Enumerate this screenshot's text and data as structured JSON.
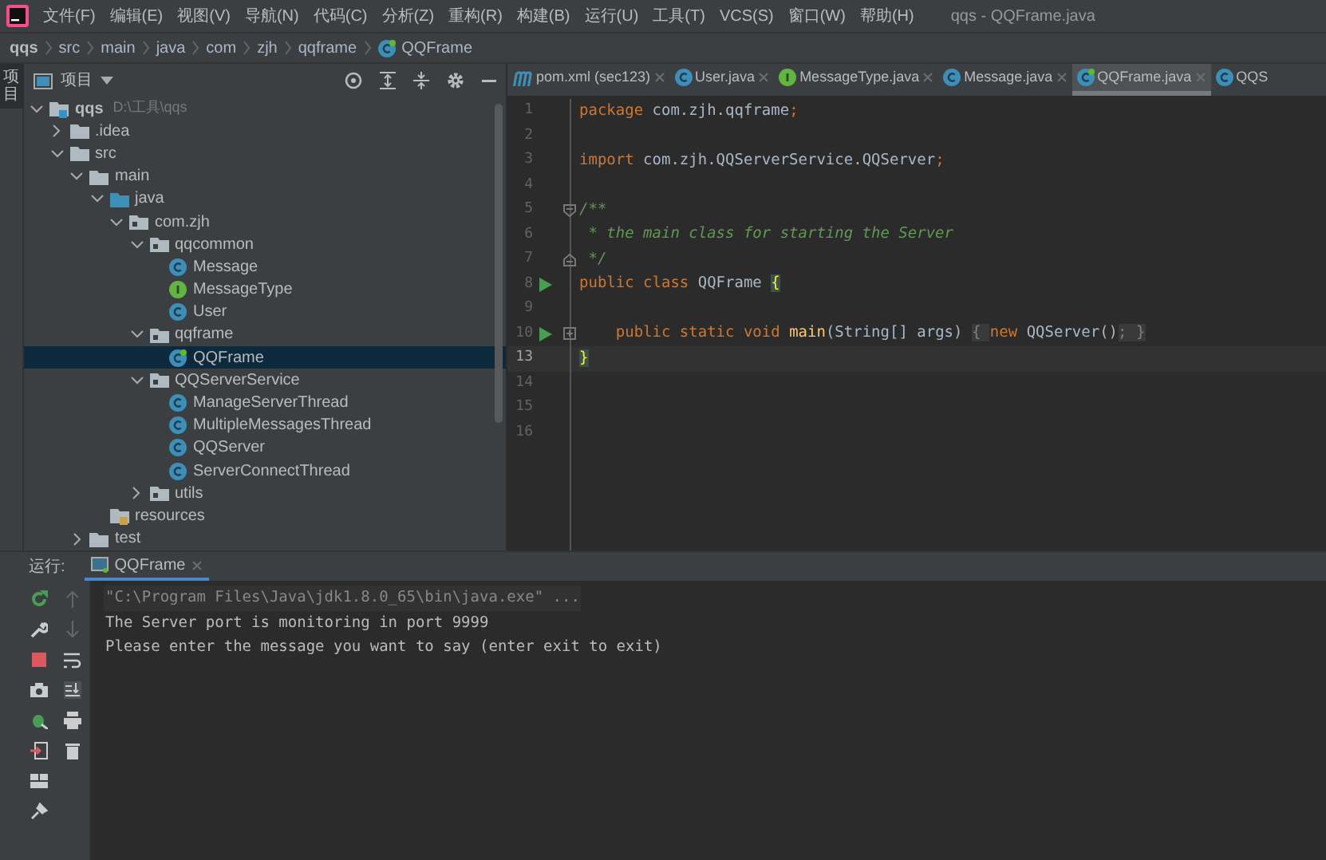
{
  "window": {
    "title": "qqs - QQFrame.java"
  },
  "menu": [
    "文件(F)",
    "编辑(E)",
    "视图(V)",
    "导航(N)",
    "代码(C)",
    "分析(Z)",
    "重构(R)",
    "构建(B)",
    "运行(U)",
    "工具(T)",
    "VCS(S)",
    "窗口(W)",
    "帮助(H)"
  ],
  "breadcrumb": [
    "qqs",
    "src",
    "main",
    "java",
    "com",
    "zjh",
    "qqframe",
    "QQFrame"
  ],
  "side_stripe": {
    "label": "项目"
  },
  "project_panel": {
    "title": "项目",
    "tree": [
      {
        "label": "qqs",
        "path": "D:\\工具\\qqs",
        "kind": "module",
        "expanded": true,
        "selected": false,
        "children": [
          {
            "label": ".idea",
            "kind": "folder",
            "expanded": false,
            "selected": false
          },
          {
            "label": "src",
            "kind": "folder",
            "expanded": true,
            "selected": false,
            "children": [
              {
                "label": "main",
                "kind": "folder",
                "expanded": true,
                "selected": false,
                "children": [
                  {
                    "label": "java",
                    "kind": "source-folder",
                    "expanded": true,
                    "selected": false,
                    "children": [
                      {
                        "label": "com.zjh",
                        "kind": "package",
                        "expanded": true,
                        "selected": false,
                        "children": [
                          {
                            "label": "qqcommon",
                            "kind": "package",
                            "expanded": true,
                            "selected": false,
                            "children": [
                              {
                                "label": "Message",
                                "kind": "class",
                                "selected": false
                              },
                              {
                                "label": "MessageType",
                                "kind": "interface",
                                "selected": false
                              },
                              {
                                "label": "User",
                                "kind": "class",
                                "selected": false
                              }
                            ]
                          },
                          {
                            "label": "qqframe",
                            "kind": "package",
                            "expanded": true,
                            "selected": false,
                            "children": [
                              {
                                "label": "QQFrame",
                                "kind": "main-class",
                                "selected": true
                              }
                            ]
                          },
                          {
                            "label": "QQServerService",
                            "kind": "package",
                            "expanded": true,
                            "selected": false,
                            "children": [
                              {
                                "label": "ManageServerThread",
                                "kind": "class",
                                "selected": false
                              },
                              {
                                "label": "MultipleMessagesThread",
                                "kind": "class",
                                "selected": false
                              },
                              {
                                "label": "QQServer",
                                "kind": "class",
                                "selected": false
                              },
                              {
                                "label": "ServerConnectThread",
                                "kind": "class",
                                "selected": false
                              }
                            ]
                          },
                          {
                            "label": "utils",
                            "kind": "package",
                            "expanded": false,
                            "selected": false
                          }
                        ]
                      }
                    ]
                  },
                  {
                    "label": "resources",
                    "kind": "resources",
                    "selected": false
                  }
                ]
              },
              {
                "label": "test",
                "kind": "folder",
                "expanded": false,
                "selected": false
              }
            ]
          }
        ]
      }
    ]
  },
  "editor_tabs": [
    {
      "label": "pom.xml (sec123)",
      "kind": "maven",
      "selected": false
    },
    {
      "label": "User.java",
      "kind": "class",
      "selected": false
    },
    {
      "label": "MessageType.java",
      "kind": "interface",
      "selected": false
    },
    {
      "label": "Message.java",
      "kind": "class",
      "selected": false
    },
    {
      "label": "QQFrame.java",
      "kind": "main-class",
      "selected": true
    },
    {
      "label": "QQS",
      "kind": "class",
      "selected": false
    }
  ],
  "code": [
    {
      "number": "1",
      "tokens": [
        {
          "kind": "keyword",
          "text": "package"
        },
        {
          "kind": "plain",
          "text": " com.zjh.qqframe"
        },
        {
          "kind": "keyword",
          "text": ";"
        }
      ]
    },
    {
      "number": "2"
    },
    {
      "number": "3",
      "tokens": [
        {
          "kind": "keyword",
          "text": "import"
        },
        {
          "kind": "plain",
          "text": " com.zjh.QQServerService.QQServer"
        },
        {
          "kind": "keyword",
          "text": ";"
        }
      ]
    },
    {
      "number": "4"
    },
    {
      "number": "5",
      "kind": "fold-start",
      "tokens": [
        {
          "kind": "comment",
          "text": "/**"
        }
      ]
    },
    {
      "number": "6",
      "tokens": [
        {
          "kind": "comment",
          "text": " * the main class for starting the Server"
        }
      ]
    },
    {
      "number": "7",
      "kind": "fold-end",
      "tokens": [
        {
          "kind": "comment",
          "text": " */"
        }
      ]
    },
    {
      "number": "8",
      "run": true,
      "tokens": [
        {
          "kind": "keyword",
          "text": "public class"
        },
        {
          "kind": "plain",
          "text": " QQFrame "
        },
        {
          "kind": "brace",
          "text": "{"
        }
      ]
    },
    {
      "number": "9"
    },
    {
      "number": "10",
      "run": true,
      "kind": "fold-collapsed",
      "tokens": [
        {
          "kind": "keyword",
          "text": "    public static void "
        },
        {
          "kind": "method",
          "text": "main"
        },
        {
          "kind": "plain",
          "text": "(String[] args) "
        },
        {
          "kind": "folded",
          "text": "{ "
        },
        {
          "kind": "keyword",
          "text": "new"
        },
        {
          "kind": "plain",
          "text": " QQServer()"
        },
        {
          "kind": "folded",
          "text": "; }"
        }
      ]
    },
    {
      "number": "13",
      "current": true,
      "tokens": [
        {
          "kind": "brace",
          "text": "}"
        }
      ]
    },
    {
      "number": "14"
    },
    {
      "number": "15"
    },
    {
      "number": "16"
    }
  ],
  "run_panel": {
    "label": "运行:",
    "tab": "QQFrame",
    "console": [
      {
        "kind": "command",
        "text": "\"C:\\Program Files\\Java\\jdk1.8.0_65\\bin\\java.exe\" ..."
      },
      {
        "kind": "output",
        "text": "The Server port is monitoring in port 9999"
      },
      {
        "kind": "output",
        "text": "Please enter the message you want to say (enter exit to exit)"
      }
    ]
  }
}
